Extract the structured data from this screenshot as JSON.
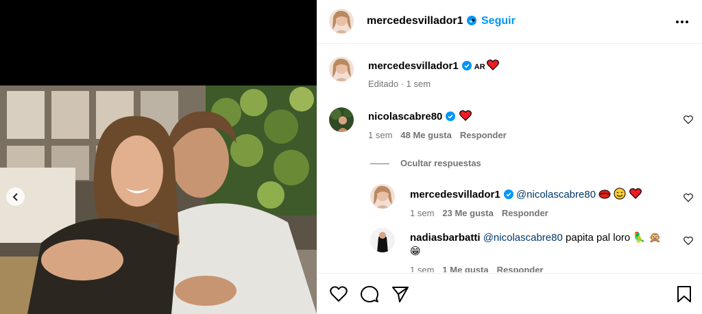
{
  "post": {
    "username": "mercedesvillador1",
    "follow_label": "Seguir",
    "separator": "•",
    "caption_badge": "AR",
    "caption_meta": "Editado · 1 sem"
  },
  "comments": [
    {
      "username": "nicolascabre80",
      "time": "1 sem",
      "likes": "48 Me gusta",
      "reply_label": "Responder"
    }
  ],
  "hide_replies_label": "Ocultar respuestas",
  "replies": [
    {
      "username": "mercedesvillador1",
      "mention": "@nicolascabre80",
      "time": "1 sem",
      "likes": "23 Me gusta",
      "reply_label": "Responder"
    },
    {
      "username": "nadiasbarbatti",
      "mention": "@nicolascabre80",
      "text": "papita pal loro 🦜 🙊",
      "text2": "😁",
      "time": "1 sem",
      "likes": "1 Me gusta",
      "reply_label": "Responder"
    }
  ],
  "icons": {
    "like": "heart-icon",
    "comment": "comment-icon",
    "share": "send-icon",
    "save": "bookmark-icon",
    "more": "more-options-icon",
    "verified": "verified-badge-icon",
    "prev": "chevron-left-icon"
  },
  "colors": {
    "accent": "#0095f6",
    "verified": "#0095f6",
    "heart": "#ed1c24",
    "meta_text": "#737373",
    "mention": "#00376b"
  }
}
